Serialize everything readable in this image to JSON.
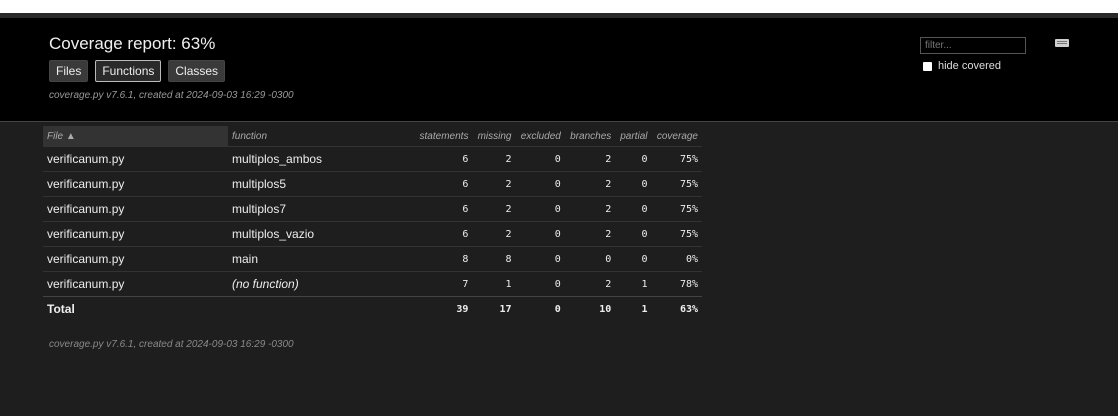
{
  "header": {
    "title": "Coverage report: 63%",
    "buttons": [
      "Files",
      "Functions",
      "Classes"
    ],
    "meta": "coverage.py v7.6.1, created at 2024-09-03 16:29 -0300",
    "filter_placeholder": "filter...",
    "hide_covered_label": "hide covered"
  },
  "table": {
    "columns": {
      "file": "File ▲",
      "function": "function",
      "statements": "statements",
      "missing": "missing",
      "excluded": "excluded",
      "branches": "branches",
      "partial": "partial",
      "coverage": "coverage"
    },
    "rows": [
      {
        "file": "verificanum.py",
        "function": "multiplos_ambos",
        "statements": "6",
        "missing": "2",
        "excluded": "0",
        "branches": "2",
        "partial": "0",
        "coverage": "75%"
      },
      {
        "file": "verificanum.py",
        "function": "multiplos5",
        "statements": "6",
        "missing": "2",
        "excluded": "0",
        "branches": "2",
        "partial": "0",
        "coverage": "75%"
      },
      {
        "file": "verificanum.py",
        "function": "multiplos7",
        "statements": "6",
        "missing": "2",
        "excluded": "0",
        "branches": "2",
        "partial": "0",
        "coverage": "75%"
      },
      {
        "file": "verificanum.py",
        "function": "multiplos_vazio",
        "statements": "6",
        "missing": "2",
        "excluded": "0",
        "branches": "2",
        "partial": "0",
        "coverage": "75%"
      },
      {
        "file": "verificanum.py",
        "function": "main",
        "statements": "8",
        "missing": "8",
        "excluded": "0",
        "branches": "0",
        "partial": "0",
        "coverage": "0%"
      },
      {
        "file": "verificanum.py",
        "function": "(no function)",
        "statements": "7",
        "missing": "1",
        "excluded": "0",
        "branches": "2",
        "partial": "1",
        "coverage": "78%"
      }
    ],
    "total": {
      "label": "Total",
      "statements": "39",
      "missing": "17",
      "excluded": "0",
      "branches": "10",
      "partial": "1",
      "coverage": "63%"
    }
  },
  "footer": {
    "meta": "coverage.py v7.6.1, created at 2024-09-03 16:29 -0300"
  }
}
